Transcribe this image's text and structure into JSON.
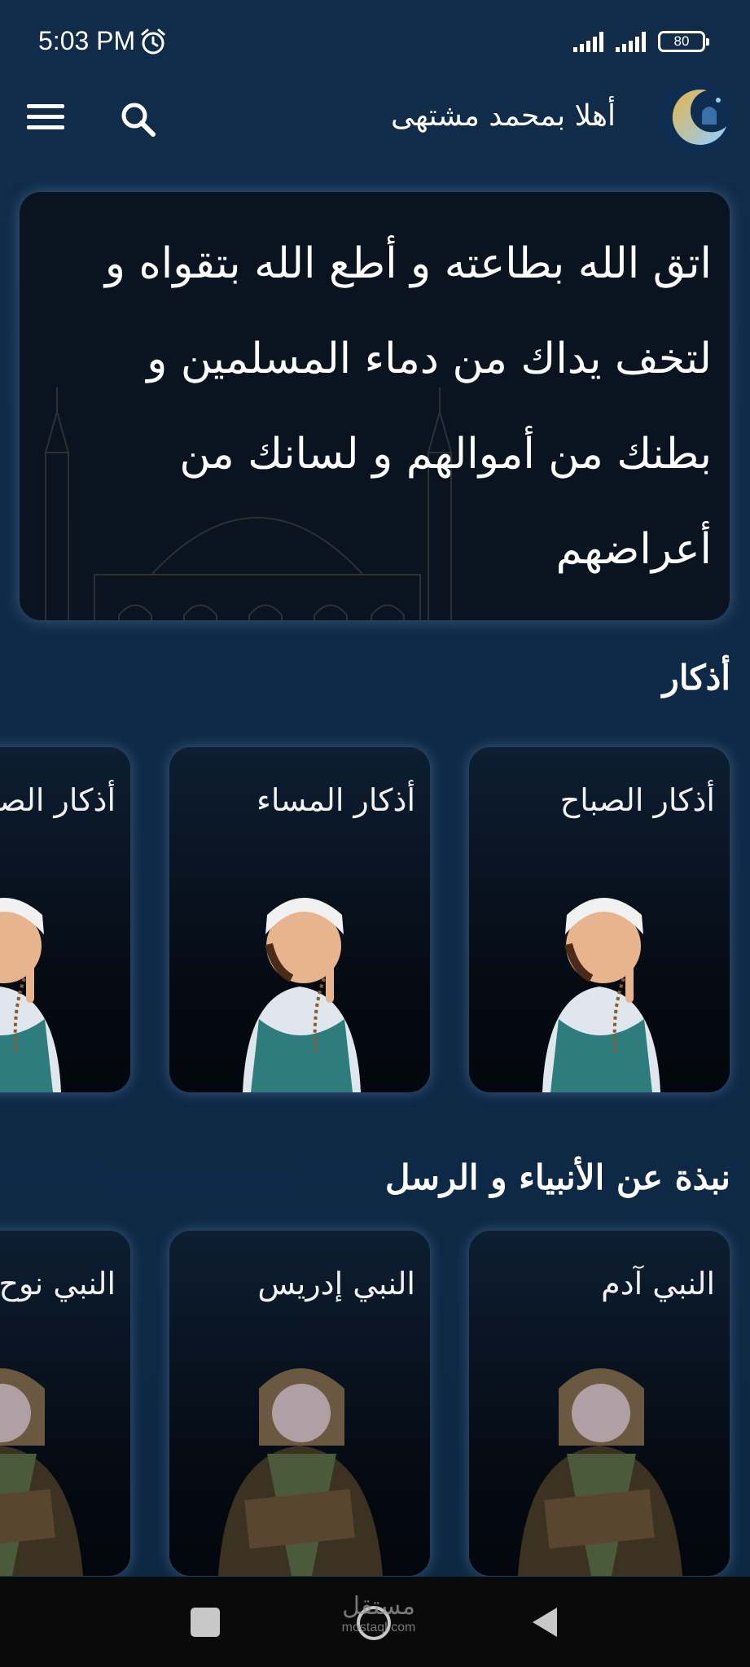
{
  "status_bar": {
    "time": "5:03 PM",
    "battery": "80",
    "icons": [
      "alarm-icon",
      "signal-icon",
      "signal-icon",
      "battery-icon"
    ]
  },
  "app_bar": {
    "greeting": "أهلا بمحمد مشتهى",
    "icons": [
      "menu-icon",
      "search-icon",
      "crescent-logo-icon"
    ]
  },
  "banner": {
    "quote": "اتق الله بطاعته و أطع الله بتقواه و لتخف يداك من دماء المسلمين و بطنك من أموالهم و لسانك من أعراضهم"
  },
  "sections": {
    "adhkar": {
      "title": "أذكار",
      "cards": [
        {
          "label": "أذكار الصباح",
          "art": "praying-boy-art"
        },
        {
          "label": "أذكار المساء",
          "art": "praying-boy-art"
        },
        {
          "label": "أذكار الصلاة",
          "art": "praying-boy-art"
        }
      ]
    },
    "prophets": {
      "title": "نبذة عن الأنبياء و الرسل",
      "cards": [
        {
          "label": "النبي آدم",
          "art": "prophet-figure-art"
        },
        {
          "label": "النبي إدريس",
          "art": "prophet-figure-art"
        },
        {
          "label": "النبي نوح",
          "art": "prophet-figure-art"
        }
      ]
    }
  },
  "nav_bar": {
    "watermark_ar": "مستقل",
    "watermark_en": "mostaql.com",
    "icons": [
      "recent-apps-icon",
      "home-icon",
      "back-icon"
    ]
  },
  "colors": {
    "background": "#0f2a45",
    "card_glow": "#6e96c8",
    "card_bg": "#050a12"
  }
}
